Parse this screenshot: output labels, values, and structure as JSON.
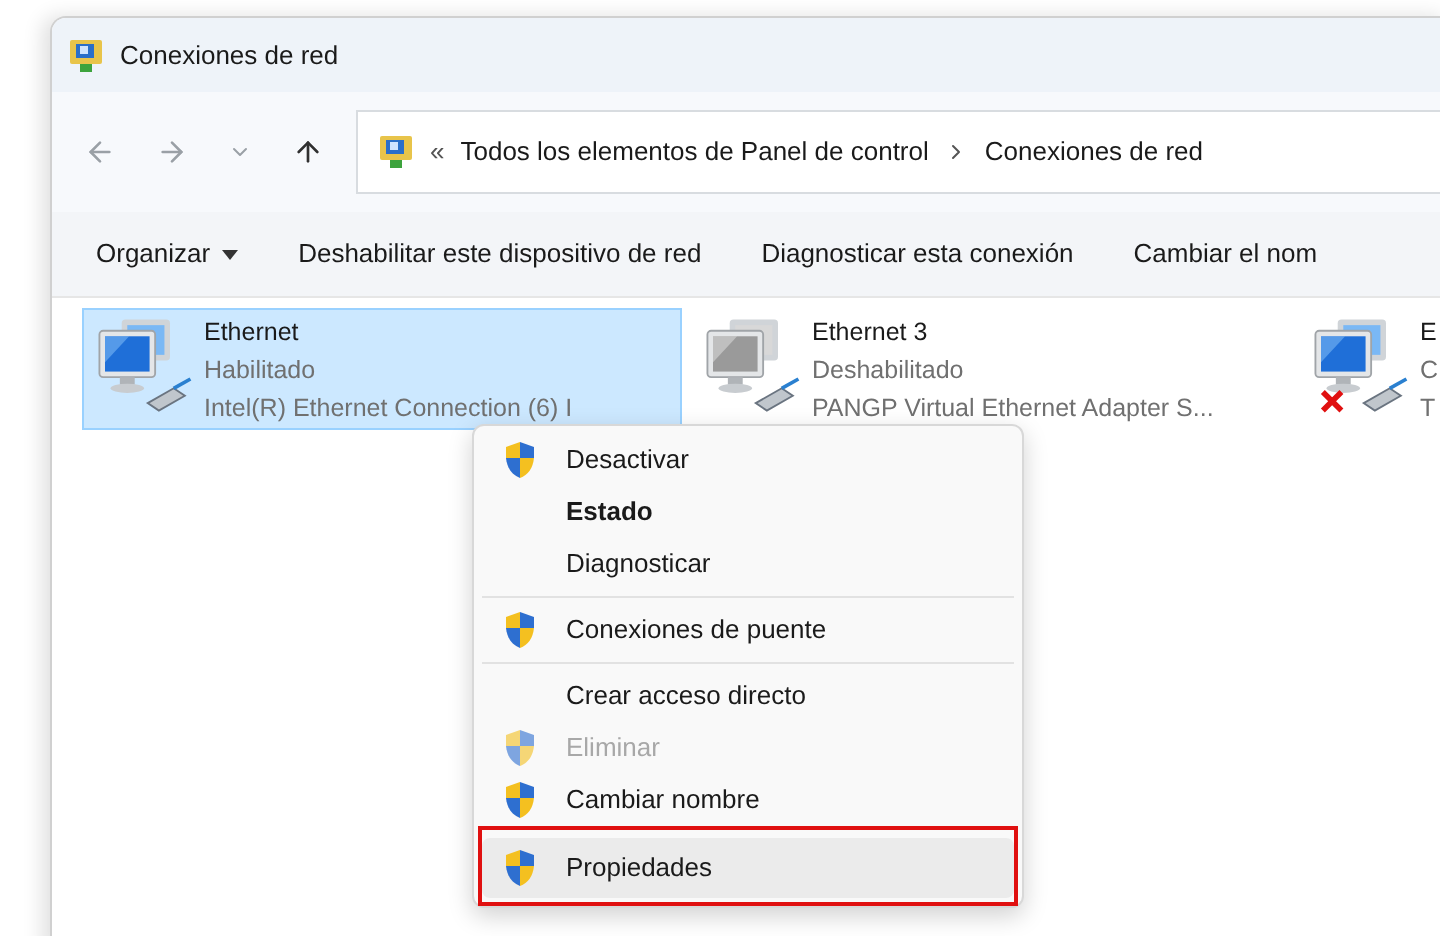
{
  "window": {
    "title": "Conexiones de red"
  },
  "navigation": {
    "back_disabled": true,
    "forward_disabled": true
  },
  "address": {
    "overflow": "«",
    "path": [
      "Todos los elementos de Panel de control",
      "Conexiones de red"
    ]
  },
  "command_bar": [
    {
      "label": "Organizar",
      "dropdown": true
    },
    {
      "label": "Deshabilitar este dispositivo de red",
      "dropdown": false
    },
    {
      "label": "Diagnosticar esta conexión",
      "dropdown": false
    },
    {
      "label": "Cambiar el nom",
      "dropdown": false
    }
  ],
  "connections": [
    {
      "name": "Ethernet",
      "status": "Habilitado",
      "device": "Intel(R) Ethernet Connection (6) I",
      "kind": "enabled",
      "selected": true
    },
    {
      "name": "Ethernet 3",
      "status": "Deshabilitado",
      "device": "PANGP Virtual Ethernet Adapter S...",
      "kind": "disabled",
      "selected": false
    },
    {
      "name": "E",
      "status": "C",
      "device": "T",
      "kind": "error",
      "selected": false
    }
  ],
  "context_menu": {
    "groups": [
      [
        {
          "label": "Desactivar",
          "shield": true,
          "bold": false,
          "disabled": false,
          "selected": false,
          "outlined": false
        },
        {
          "label": "Estado",
          "shield": false,
          "bold": true,
          "disabled": false,
          "selected": false,
          "outlined": false
        },
        {
          "label": "Diagnosticar",
          "shield": false,
          "bold": false,
          "disabled": false,
          "selected": false,
          "outlined": false
        }
      ],
      [
        {
          "label": "Conexiones de puente",
          "shield": true,
          "bold": false,
          "disabled": false,
          "selected": false,
          "outlined": false
        }
      ],
      [
        {
          "label": "Crear acceso directo",
          "shield": false,
          "bold": false,
          "disabled": false,
          "selected": false,
          "outlined": false
        },
        {
          "label": "Eliminar",
          "shield": true,
          "bold": false,
          "disabled": true,
          "selected": false,
          "outlined": false
        },
        {
          "label": "Cambiar nombre",
          "shield": true,
          "bold": false,
          "disabled": false,
          "selected": false,
          "outlined": false
        },
        {
          "label": "Propiedades",
          "shield": true,
          "bold": false,
          "disabled": false,
          "selected": true,
          "outlined": true
        }
      ]
    ]
  }
}
